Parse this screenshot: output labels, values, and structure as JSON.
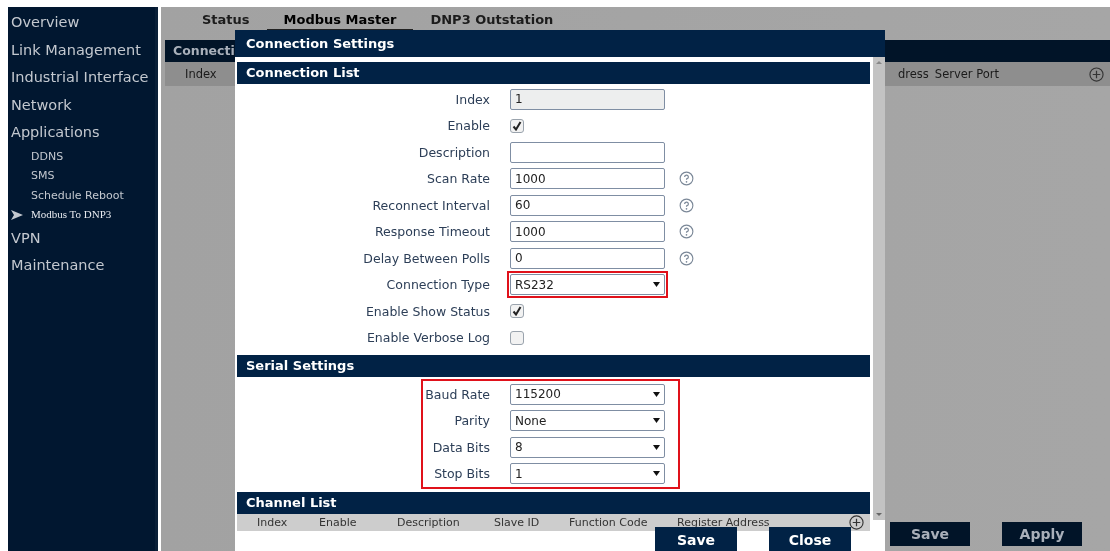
{
  "sidebar": {
    "items": [
      {
        "label": "Overview",
        "selected": false
      },
      {
        "label": "Link Management",
        "selected": false
      },
      {
        "label": "Industrial Interface",
        "selected": false
      },
      {
        "label": "Network",
        "selected": false
      },
      {
        "label": "Applications",
        "selected": false,
        "children": [
          {
            "label": "DDNS",
            "selected": false
          },
          {
            "label": "SMS",
            "selected": false
          },
          {
            "label": "Schedule Reboot",
            "selected": false
          },
          {
            "label": "Modbus To DNP3",
            "selected": true
          }
        ]
      },
      {
        "label": "VPN",
        "selected": false
      },
      {
        "label": "Maintenance",
        "selected": false
      }
    ]
  },
  "tabs": [
    {
      "label": "Status",
      "selected": false
    },
    {
      "label": "Modbus Master",
      "selected": true
    },
    {
      "label": "DNP3 Outstation",
      "selected": false
    }
  ],
  "background_panel": {
    "title": "Connecti",
    "columns_left": [
      "Index"
    ],
    "columns_right": [
      "dress",
      "Server Port"
    ]
  },
  "background_buttons": [
    "Save",
    "Apply"
  ],
  "dialog": {
    "title": "Connection Settings",
    "connection_list": {
      "title": "Connection List",
      "fields": [
        {
          "label": "Index",
          "kind": "readonly",
          "value": "1",
          "help": false,
          "highlighted": false
        },
        {
          "label": "Enable",
          "kind": "checkbox",
          "checked": true,
          "help": false,
          "highlighted": false
        },
        {
          "label": "Description",
          "kind": "text",
          "help": false,
          "highlighted": false
        },
        {
          "label": "Scan Rate",
          "kind": "text",
          "value": "1000",
          "help": true,
          "highlighted": false
        },
        {
          "label": "Reconnect Interval",
          "kind": "text",
          "value": "60",
          "help": true,
          "highlighted": false
        },
        {
          "label": "Response Timeout",
          "kind": "text",
          "value": "1000",
          "help": true,
          "highlighted": false
        },
        {
          "label": "Delay Between Polls",
          "kind": "text",
          "value": "0",
          "help": true,
          "highlighted": false
        },
        {
          "label": "Connection Type",
          "kind": "select",
          "value": "RS232",
          "help": false,
          "highlighted": true
        },
        {
          "label": "Enable Show Status",
          "kind": "checkbox",
          "checked": true,
          "help": false,
          "highlighted": false
        },
        {
          "label": "Enable Verbose Log",
          "kind": "checkbox",
          "checked": false,
          "help": false,
          "highlighted": false
        }
      ]
    },
    "serial_settings": {
      "title": "Serial Settings",
      "highlighted": true,
      "fields": [
        {
          "label": "Baud Rate",
          "kind": "select",
          "value": "115200",
          "help": false,
          "highlighted": false
        },
        {
          "label": "Parity",
          "kind": "select",
          "value": "None",
          "help": false,
          "highlighted": false
        },
        {
          "label": "Data Bits",
          "kind": "select",
          "value": "8",
          "help": false,
          "highlighted": false
        },
        {
          "label": "Stop Bits",
          "kind": "select",
          "value": "1",
          "help": false,
          "highlighted": false
        }
      ]
    },
    "channel_list": {
      "title": "Channel List",
      "columns": [
        "Index",
        "Enable",
        "Description",
        "Slave ID",
        "Function Code",
        "Register Address"
      ]
    },
    "buttons": [
      "Save",
      "Close"
    ]
  }
}
